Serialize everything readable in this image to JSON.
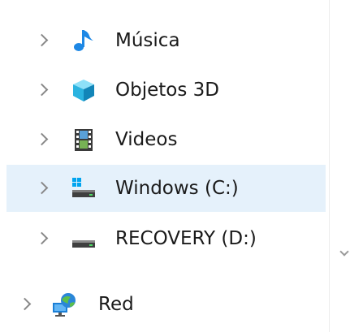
{
  "nav_pane": {
    "items": [
      {
        "label": "Música",
        "icon": "music-note-icon",
        "selected": false
      },
      {
        "label": "Objetos 3D",
        "icon": "3d-objects-icon",
        "selected": false
      },
      {
        "label": "Videos",
        "icon": "film-strip-icon",
        "selected": false
      },
      {
        "label": "Windows (C:)",
        "icon": "windows-drive-icon",
        "selected": true
      },
      {
        "label": "RECOVERY (D:)",
        "icon": "hard-drive-icon",
        "selected": false
      }
    ],
    "network": {
      "label": "Red",
      "icon": "network-icon"
    }
  },
  "colors": {
    "selected_background": "#e5f1fb",
    "music_note": "#1e88e5",
    "cube": "#2bb3e0",
    "chevron": "#888888"
  }
}
